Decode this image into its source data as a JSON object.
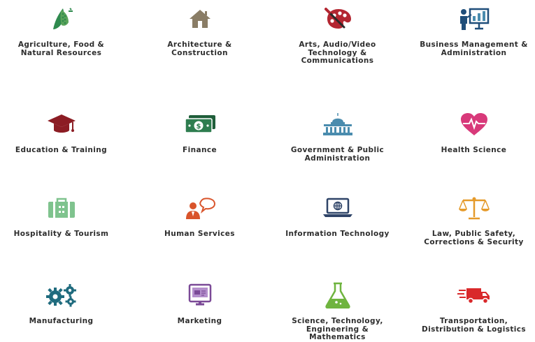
{
  "clusters": [
    {
      "label": "Agriculture, Food &\nNatural Resources",
      "icon": "corn-icon",
      "color": "#2f8a4e"
    },
    {
      "label": "Architecture &\nConstruction",
      "icon": "house-icon",
      "color": "#8a7d66"
    },
    {
      "label": "Arts, Audio/Video\nTechnology &\nCommunications",
      "icon": "palette-brush-icon",
      "color": "#b32631"
    },
    {
      "label": "Business Management &\nAdministration",
      "icon": "presenter-board-icon",
      "color": "#1f4e7a"
    },
    {
      "label": "Education & Training",
      "icon": "graduation-cap-icon",
      "color": "#8c1d24"
    },
    {
      "label": "Finance",
      "icon": "money-bills-icon",
      "color": "#2e7d4f"
    },
    {
      "label": "Government & Public\nAdministration",
      "icon": "capitol-building-icon",
      "color": "#4a8cae"
    },
    {
      "label": "Health Science",
      "icon": "heart-pulse-icon",
      "color": "#d8397a"
    },
    {
      "label": "Hospitality & Tourism",
      "icon": "suitcase-icon",
      "color": "#7fc38e"
    },
    {
      "label": "Human Services",
      "icon": "person-speech-icon",
      "color": "#d9542b"
    },
    {
      "label": "Information Technology",
      "icon": "laptop-globe-icon",
      "color": "#2f4468"
    },
    {
      "label": "Law, Public Safety,\nCorrections & Security",
      "icon": "scales-icon",
      "color": "#e59a2a"
    },
    {
      "label": "Manufacturing",
      "icon": "gears-icon",
      "color": "#1f6b7e"
    },
    {
      "label": "Marketing",
      "icon": "monitor-chart-icon",
      "color": "#7b4a97"
    },
    {
      "label": "Science, Technology,\nEngineering &\nMathematics",
      "icon": "flask-icon",
      "color": "#6fb43f"
    },
    {
      "label": "Transportation,\nDistribution & Logistics",
      "icon": "truck-icon",
      "color": "#d9292b"
    }
  ]
}
